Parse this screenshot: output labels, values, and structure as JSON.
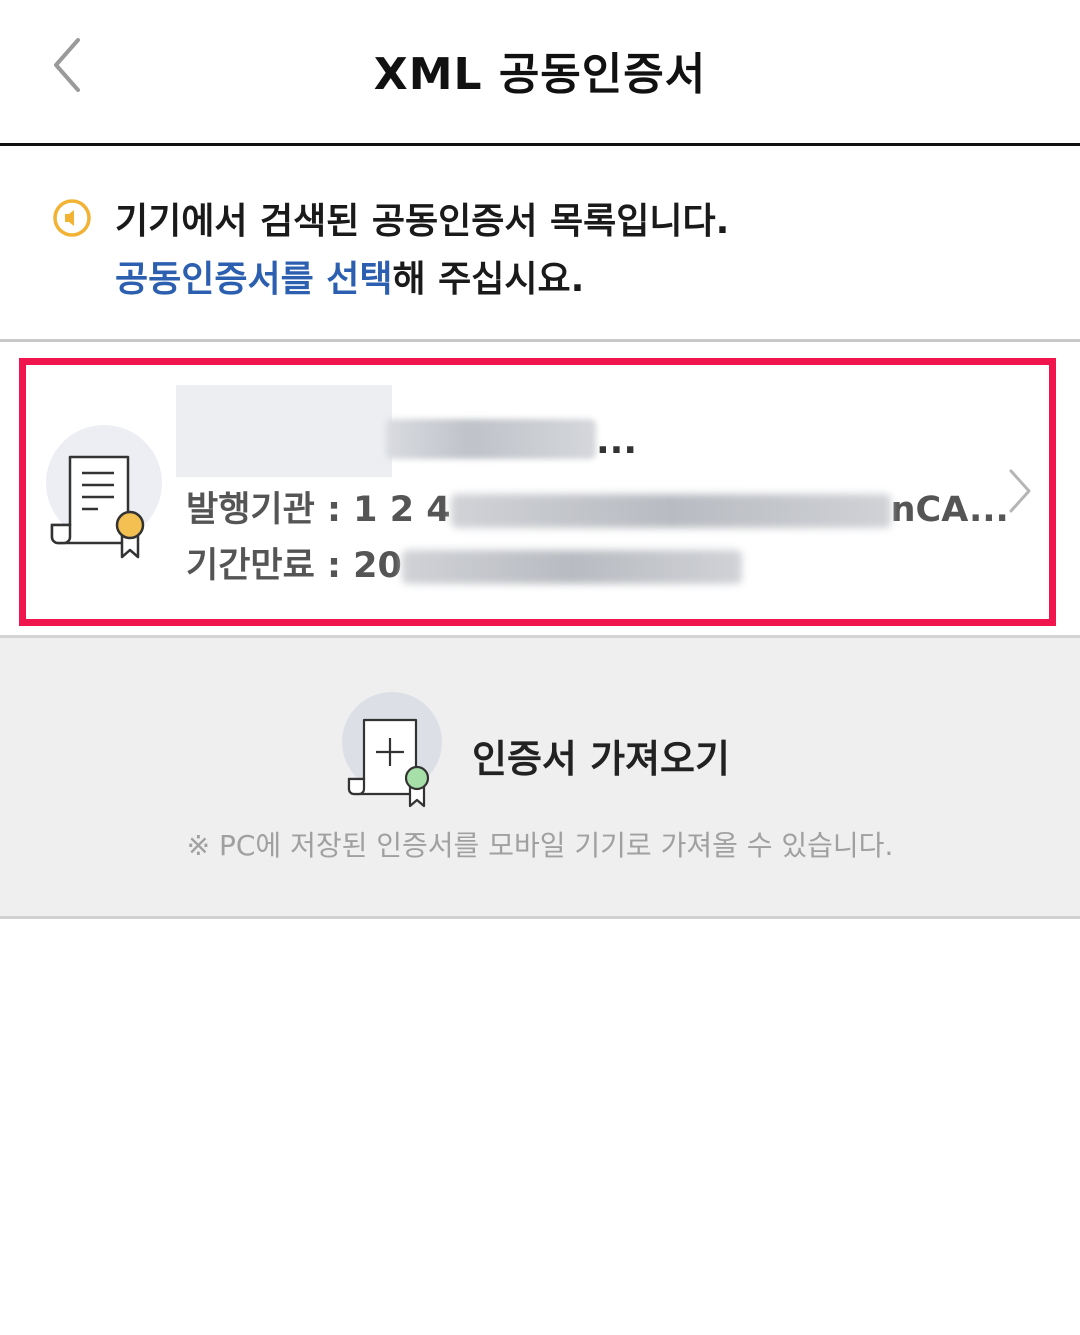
{
  "header": {
    "title": "XML 공동인증서"
  },
  "notice": {
    "line1": "기기에서 검색된 공동인증서 목록입니다.",
    "line2_accent": "공동인증서를 선택",
    "line2_rest": "해 주십시요."
  },
  "certificate": {
    "name_suffix": "...",
    "issuer_label": "발행기관 : ",
    "issuer_value_prefix": "1 2 4",
    "issuer_value_suffix": "nCA...",
    "expiry_label": "기간만료 : ",
    "expiry_value_prefix": "20"
  },
  "import": {
    "label": "인증서 가져오기",
    "note": "※ PC에 저장된 인증서를 모바일 기기로 가져올 수 있습니다."
  },
  "colors": {
    "accent": "#2d5fb0",
    "highlight_border": "#f0154c",
    "notice_icon": "#f2b233",
    "cert_badge": "#f5c052",
    "import_badge": "#a6dfa7"
  }
}
